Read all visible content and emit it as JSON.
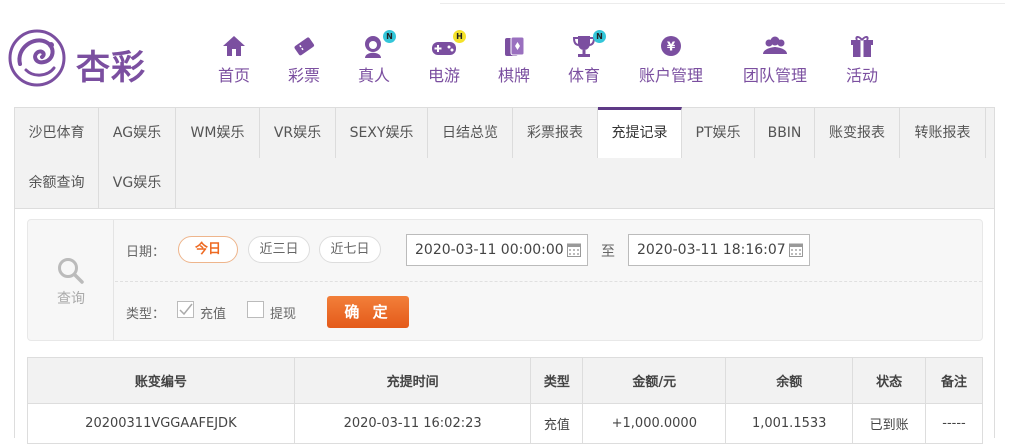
{
  "brand": {
    "logo_text": "杏彩",
    "accent": "#7b4fa0",
    "orange": "#ee6a22"
  },
  "nav": [
    {
      "label": "首页",
      "icon": "home-icon"
    },
    {
      "label": "彩票",
      "icon": "ticket-icon"
    },
    {
      "label": "真人",
      "icon": "live-dealer-icon",
      "badge": "N"
    },
    {
      "label": "电游",
      "icon": "gamepad-icon",
      "badge": "H"
    },
    {
      "label": "棋牌",
      "icon": "cards-icon"
    },
    {
      "label": "体育",
      "icon": "trophy-icon",
      "badge": "N"
    },
    {
      "label": "账户管理",
      "icon": "yen-icon"
    },
    {
      "label": "团队管理",
      "icon": "team-icon"
    },
    {
      "label": "活动",
      "icon": "gift-icon"
    }
  ],
  "tabs": [
    "沙巴体育",
    "AG娱乐",
    "WM娱乐",
    "VR娱乐",
    "SEXY娱乐",
    "日结总览",
    "彩票报表",
    "充提记录",
    "PT娱乐",
    "BBIN",
    "账变报表",
    "转账报表",
    "余额查询",
    "VG娱乐"
  ],
  "active_tab": "充提记录",
  "search": {
    "title": "查询",
    "date_label": "日期：",
    "ranges": [
      "今日",
      "近三日",
      "近七日"
    ],
    "active_range": "今日",
    "start": "2020-03-11 00:00:00",
    "to_label": "至",
    "end": "2020-03-11 18:16:07",
    "type_label": "类型：",
    "types": [
      {
        "label": "充值",
        "checked": true
      },
      {
        "label": "提现",
        "checked": false
      }
    ],
    "confirm": "确 定"
  },
  "table": {
    "headers": [
      "账变编号",
      "充提时间",
      "类型",
      "金额/元",
      "余额",
      "状态",
      "备注"
    ],
    "rows": [
      [
        "20200311VGGAAFEJDK",
        "2020-03-11 16:02:23",
        "充值",
        "+1,000.0000",
        "1,001.1533",
        "已到账",
        "-----"
      ]
    ]
  }
}
